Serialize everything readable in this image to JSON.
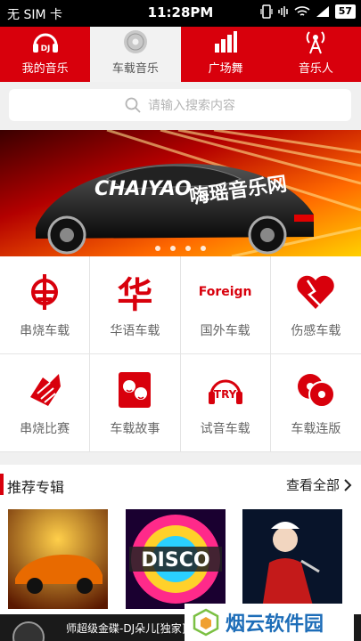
{
  "status_bar": {
    "carrier": "无 SIM 卡",
    "time": "11:28PM",
    "battery": "57"
  },
  "top_nav": {
    "tabs": [
      {
        "label": "我的音乐",
        "icon": "dj-headphones-icon",
        "active": false
      },
      {
        "label": "车载音乐",
        "icon": "disc-icon",
        "active": true
      },
      {
        "label": "广场舞",
        "icon": "bar-chart-icon",
        "active": false
      },
      {
        "label": "音乐人",
        "icon": "antenna-icon",
        "active": false
      }
    ]
  },
  "search": {
    "placeholder": "请输入搜索内容"
  },
  "banner": {
    "brand": "CHAIYAO",
    "brand_cn": "嗨瑶音乐网",
    "pages": 4
  },
  "categories": [
    {
      "label": "串烧车载",
      "icon": "medley-icon"
    },
    {
      "label": "华语车载",
      "icon": "chinese-char-icon",
      "glyph": "华"
    },
    {
      "label": "国外车载",
      "icon": "foreign-text-icon",
      "glyph": "Foreign"
    },
    {
      "label": "伤感车载",
      "icon": "broken-heart-icon"
    },
    {
      "label": "串烧比赛",
      "icon": "handshake-icon"
    },
    {
      "label": "车载故事",
      "icon": "faces-icon"
    },
    {
      "label": "试音车载",
      "icon": "try-headphones-icon",
      "glyph": "TRY"
    },
    {
      "label": "车载连版",
      "icon": "discs-icon"
    }
  ],
  "recommend": {
    "title": "推荐专辑",
    "more": "查看全部"
  },
  "player": {
    "now_playing": "师超级金碟-DJ朵儿[独家]"
  },
  "watermark": {
    "text": "烟云软件园"
  },
  "colors": {
    "brand_red": "#d8000c",
    "bg": "#f0f0f0"
  }
}
